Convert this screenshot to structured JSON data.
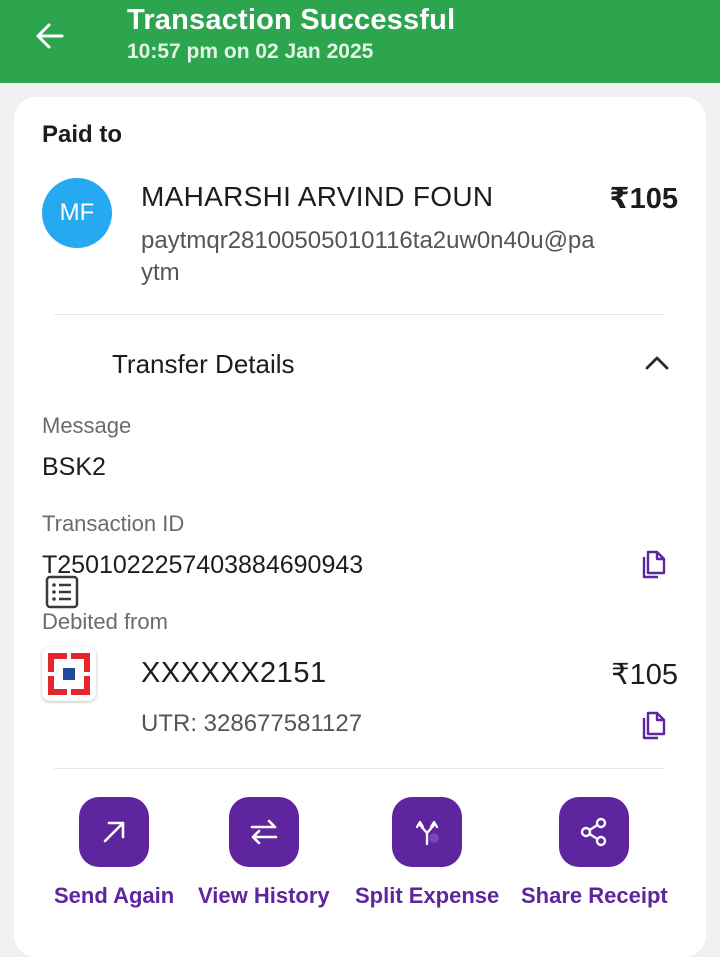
{
  "header": {
    "title": "Transaction Successful",
    "subtitle": "10:57 pm on 02 Jan 2025",
    "accent_color": "#2da44e",
    "back_icon": "arrow-left-icon"
  },
  "paid_to": {
    "label": "Paid to",
    "avatar_initials": "MF",
    "avatar_color": "#26a9f0",
    "name": "MAHARSHI ARVIND FOUN",
    "amount": "₹105",
    "upi_id": "paytmqr28100505010116ta2uw0n40u@paytm"
  },
  "transfer_details": {
    "label": "Transfer Details",
    "icon": "receipt-list-icon",
    "expanded_icon": "chevron-up-icon",
    "message_label": "Message",
    "message_value": "BSK2",
    "transaction_id_label": "Transaction ID",
    "transaction_id_value": "T2501022257403884690943",
    "debited_from_label": "Debited from",
    "account": "XXXXXX2151",
    "account_amount": "₹105",
    "utr": "UTR: 328677581127"
  },
  "actions": [
    {
      "label": "Send Again",
      "icon": "arrow-up-right-icon"
    },
    {
      "label": "View History",
      "icon": "swap-arrows-icon"
    },
    {
      "label": "Split Expense",
      "icon": "split-icon"
    },
    {
      "label": "Share Receipt",
      "icon": "share-icon"
    }
  ],
  "brand_color": "#5f259f"
}
